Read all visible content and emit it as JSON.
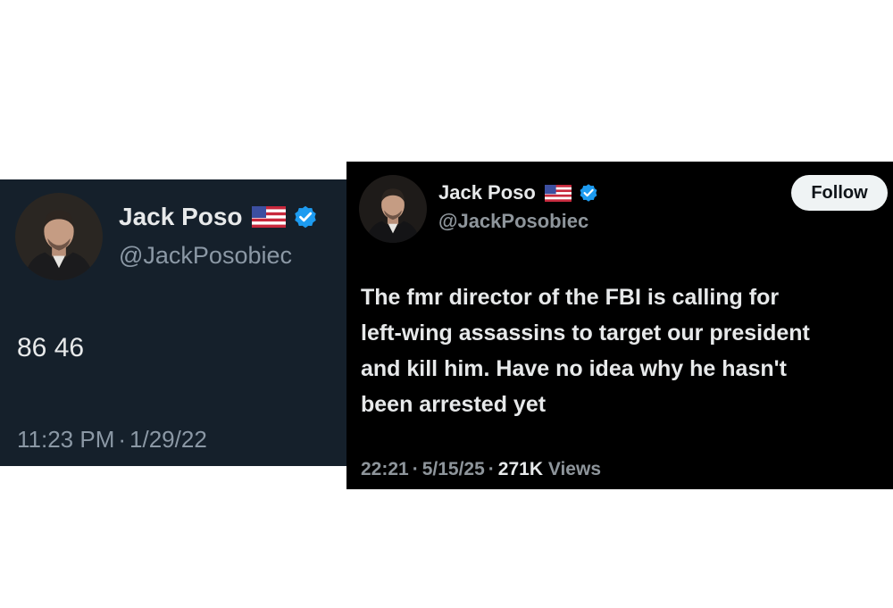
{
  "tweet_left": {
    "author_name": "Jack Poso",
    "handle": "@JackPosobiec",
    "text": "86 46",
    "time": "11:23 PM",
    "date": "1/29/22",
    "separator": "·",
    "flag_icon": "us-flag-icon",
    "verified_icon": "verified-badge-icon",
    "colors": {
      "background": "#15202b",
      "text": "#e7e9ea",
      "muted": "#8b98a5",
      "verified": "#1d9bf0"
    }
  },
  "tweet_right": {
    "author_name": "Jack Poso",
    "handle": "@JackPosobiec",
    "follow_label": "Follow",
    "text": "The fmr director of the FBI is calling for\nleft-wing assassins to target our president\nand kill him. Have no idea why he hasn't\nbeen arrested yet",
    "time": "22:21",
    "date": "5/15/25",
    "separator": "·",
    "views_count": "271K",
    "views_label": "Views",
    "flag_icon": "us-flag-icon",
    "verified_icon": "verified-badge-icon",
    "colors": {
      "background": "#000000",
      "text": "#e7e9ea",
      "muted": "#8e959b",
      "verified": "#1d9bf0"
    }
  }
}
